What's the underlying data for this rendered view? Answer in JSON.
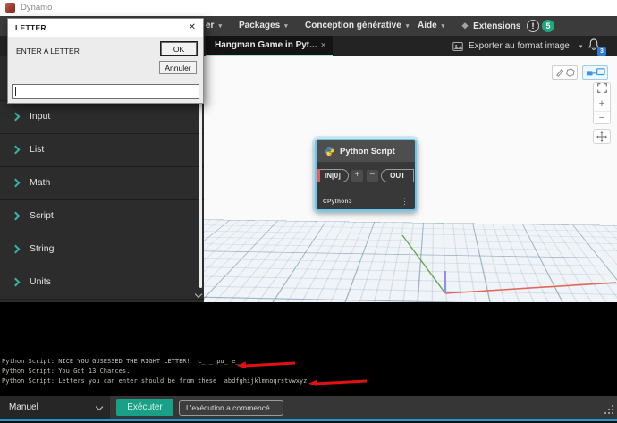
{
  "window": {
    "title": "Dynamo"
  },
  "menubar": {
    "partial_item": "er",
    "packages": "Packages",
    "generative_design": "Conception générative",
    "help": "Aide",
    "extensions": "Extensions",
    "notification_count": "5"
  },
  "tabbar": {
    "active_tab": "Hangman Game in Pyt...",
    "export_image": "Exporter au format image",
    "bell_count": "3"
  },
  "dialog": {
    "title": "LETTER",
    "prompt": "ENTER A LETTER",
    "ok_label": "OK",
    "cancel_label": "Annuler",
    "input_value": ""
  },
  "sidebar": {
    "items": [
      {
        "label": "Input"
      },
      {
        "label": "List"
      },
      {
        "label": "Math"
      },
      {
        "label": "Script"
      },
      {
        "label": "String"
      },
      {
        "label": "Units"
      }
    ]
  },
  "node": {
    "title": "Python Script",
    "input_port": "IN[0]",
    "output_port": "OUT",
    "engine": "CPython3"
  },
  "console": {
    "lines": [
      "Python Script: NICE YOU GUSESSED THE RIGHT LETTER!  c_ _ pu_ e_",
      "Python Script: You Got 13 Chances.",
      "Python Script: Letters you can enter should be from these  abdfghijklmnoqrstvwxyz"
    ]
  },
  "bottombar": {
    "run_mode": "Manuel",
    "run_button": "Exécuter",
    "status": "L'exécution a commencé..."
  },
  "glyphs": {
    "chevron_down": "▾",
    "close": "✕",
    "ellipsis_v": "⋮",
    "plus": "+",
    "minus": "−",
    "exclaim": "!",
    "extensions_icon": "❖"
  },
  "colors": {
    "accent_teal": "#38b2a7",
    "run_button": "#19a188",
    "badge_green": "#1fa87f",
    "badge_blue": "#2e7bd0",
    "arrow_red": "#e01111",
    "selection_blue": "#71c5e8",
    "tab_underline": "#a8e0d2",
    "taskbar_line": "#1b99d5"
  }
}
